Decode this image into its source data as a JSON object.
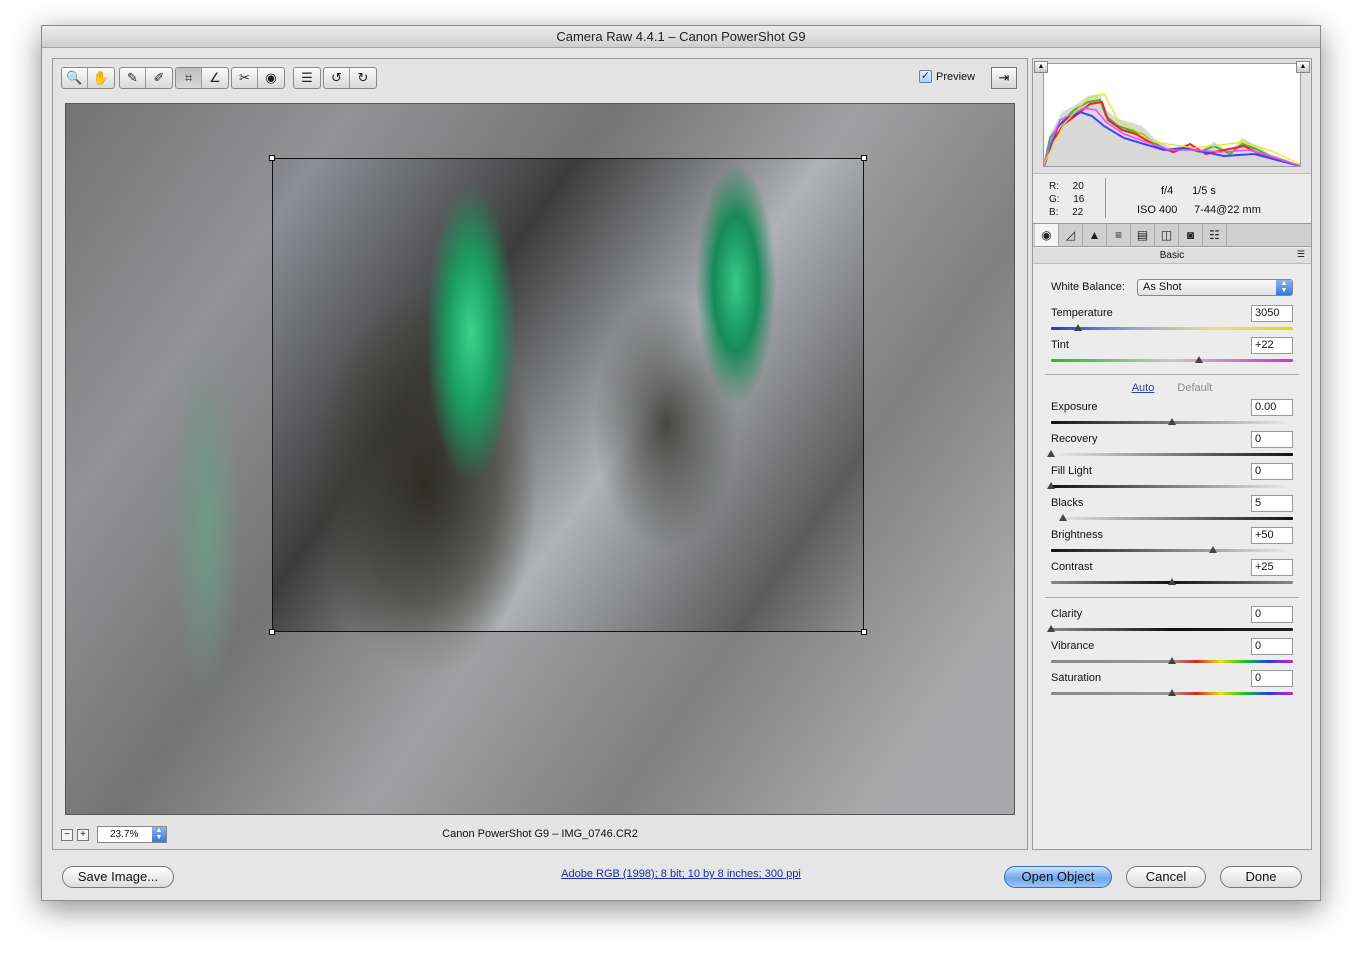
{
  "window": {
    "title": "Camera Raw 4.4.1  –  Canon PowerShot G9"
  },
  "toolbar": {
    "tools": [
      {
        "name": "zoom-tool",
        "glyph": "🔍"
      },
      {
        "name": "hand-tool",
        "glyph": "✋"
      },
      {
        "name": "white-balance-tool",
        "glyph": "✎"
      },
      {
        "name": "color-sampler-tool",
        "glyph": "✐"
      },
      {
        "name": "crop-tool",
        "glyph": "⌗"
      },
      {
        "name": "straighten-tool",
        "glyph": "∠"
      },
      {
        "name": "retouch-tool",
        "glyph": "✂"
      },
      {
        "name": "red-eye-tool",
        "glyph": "◉"
      },
      {
        "name": "preferences-tool",
        "glyph": "☰"
      },
      {
        "name": "rotate-left-tool",
        "glyph": "↺"
      },
      {
        "name": "rotate-right-tool",
        "glyph": "↻"
      }
    ],
    "preview_label": "Preview",
    "preview_checked": "✓",
    "fullscreen_glyph": "⇥"
  },
  "status": {
    "zoom_value": "23.7%",
    "zoom_minus": "−",
    "zoom_plus": "+",
    "file_label": "Canon PowerShot G9  –  IMG_0746.CR2"
  },
  "readout": {
    "r_label": "R:",
    "r": "20",
    "g_label": "G:",
    "g": "16",
    "b_label": "B:",
    "b": "22",
    "aperture": "f/4",
    "shutter": "1/5 s",
    "iso": "ISO 400",
    "lens": "7-44@22 mm"
  },
  "panel": {
    "title": "Basic",
    "menu_glyph": "☰",
    "tabs": [
      "◉",
      "◿",
      "▲",
      "≡",
      "▤",
      "◫",
      "◙",
      "☷"
    ],
    "white_balance_label": "White Balance:",
    "white_balance_value": "As Shot",
    "auto_label": "Auto",
    "default_label": "Default",
    "sliders": {
      "temperature": {
        "label": "Temperature",
        "value": "3050",
        "position": 0.11
      },
      "tint": {
        "label": "Tint",
        "value": "+22",
        "position": 0.61
      },
      "exposure": {
        "label": "Exposure",
        "value": "0.00",
        "position": 0.5
      },
      "recovery": {
        "label": "Recovery",
        "value": "0",
        "position": 0.0
      },
      "fill_light": {
        "label": "Fill Light",
        "value": "0",
        "position": 0.0
      },
      "blacks": {
        "label": "Blacks",
        "value": "5",
        "position": 0.05
      },
      "brightness": {
        "label": "Brightness",
        "value": "+50",
        "position": 0.67
      },
      "contrast": {
        "label": "Contrast",
        "value": "+25",
        "position": 0.5
      },
      "clarity": {
        "label": "Clarity",
        "value": "0",
        "position": 0.0
      },
      "vibrance": {
        "label": "Vibrance",
        "value": "0",
        "position": 0.5
      },
      "saturation": {
        "label": "Saturation",
        "value": "0",
        "position": 0.5
      }
    }
  },
  "footer": {
    "save_label": "Save Image...",
    "workflow_label": "Adobe RGB (1998); 8 bit; 10 by 8 inches; 300 ppi",
    "open_label": "Open Object",
    "cancel_label": "Cancel",
    "done_label": "Done"
  },
  "colors": {
    "accent": "#3d6fb7",
    "link": "#1a2aa8"
  }
}
